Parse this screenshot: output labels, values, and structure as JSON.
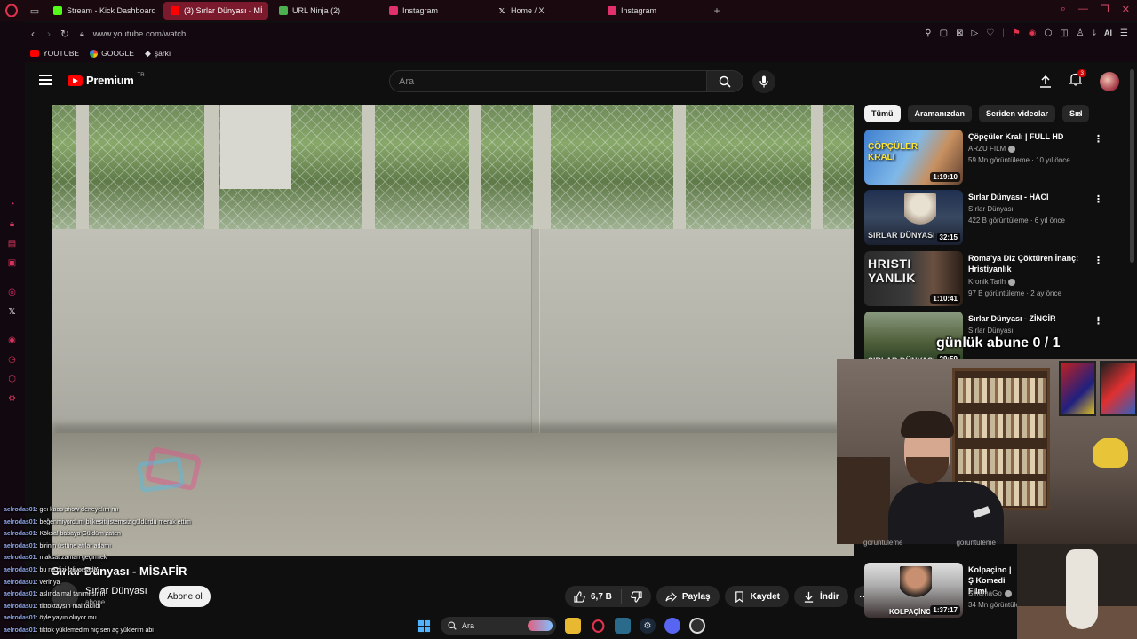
{
  "browser": {
    "tabs": [
      {
        "label": "Stream - Kick Dashboard",
        "icon": "kick-icon",
        "color": "#53fc18"
      },
      {
        "label": "(3) Sırlar Dünyası - Mİ",
        "icon": "youtube-icon",
        "color": "#ff0000",
        "active": true
      },
      {
        "label": "URL Ninja (2)",
        "icon": "ninja-icon",
        "color": "#4caf50"
      },
      {
        "label": "Instagram",
        "icon": "instagram-icon",
        "color": "#e1306c"
      },
      {
        "label": "Home / X",
        "icon": "x-icon",
        "color": "#ffffff"
      },
      {
        "label": "Instagram",
        "icon": "instagram-icon",
        "color": "#e1306c"
      }
    ],
    "new_tab": "+",
    "url": "www.youtube.com/watch",
    "bookmarks": [
      {
        "label": "YOUTUBE",
        "icon": "youtube-icon"
      },
      {
        "label": "GOOGLE",
        "icon": "google-icon"
      },
      {
        "label": "şarkı",
        "icon": "bookmark-icon"
      }
    ],
    "ai_label": "AI"
  },
  "youtube": {
    "logo_word": "Premium",
    "logo_region": "TR",
    "search_placeholder": "Ara",
    "notifications_count": "3",
    "video_title": "Sırlar Dünyası - MİSAFİR",
    "channel_name": "Sırlar Dünyası",
    "channel_subs": "abone",
    "subscribe_label": "Abone ol",
    "like_count": "6,7 B",
    "share_label": "Paylaş",
    "save_label": "Kaydet",
    "download_label": "İndir",
    "chips": [
      "Tümü",
      "Aramanızdan",
      "Seriden videolar",
      "Sırl"
    ],
    "recommendations": [
      {
        "title": "Çöpçüler Kralı | FULL HD",
        "channel": "ARZU FILM",
        "verified": true,
        "views": "59 Mn görüntüleme",
        "age": "10 yıl önce",
        "duration": "1:19:10",
        "thumb_text": "ÇÖPÇÜLER KRALI"
      },
      {
        "title": "Sırlar Dünyası - HACI",
        "channel": "Sırlar Dünyası",
        "verified": false,
        "views": "422 B görüntüleme",
        "age": "6 yıl önce",
        "duration": "32:15",
        "thumb_text": "SIRLAR DÜNYASI"
      },
      {
        "title": "Roma'ya Diz Çöktüren İnanç: Hristiyanlık",
        "channel": "Kronik Tarih",
        "verified": true,
        "views": "97 B görüntüleme",
        "age": "2 ay önce",
        "duration": "1:10:41",
        "thumb_text": "HRISTI YANLIK"
      },
      {
        "title": "Sırlar Dünyası - ZİNCİR",
        "channel": "Sırlar Dünyası",
        "verified": false,
        "views": "",
        "age": "",
        "duration": "29:59",
        "thumb_text": "SIRLAR DÜNYASI"
      }
    ],
    "partial_rec": {
      "title": "Kolpaçino | Ş Komedi Filmi",
      "channel": "SinemaGo",
      "views": "34 Mn görüntülem",
      "duration": "1:37:17",
      "thumb_text": "KOLPAÇİNO"
    },
    "hidden_views": [
      "görüntüleme",
      "görüntüleme"
    ]
  },
  "overlay": {
    "abone_goal": "günlük abune 0 / 1"
  },
  "chat": [
    {
      "user": "aelrodas01",
      "msg": "geı kaos show deneyelım mı"
    },
    {
      "user": "aelrodas01",
      "msg": "beğenmiyordum bi kesiti istemsiz güldürdü merak ettim"
    },
    {
      "user": "aelrodas01",
      "msg": "Köksal babaya Güldüm zaten"
    },
    {
      "user": "aelrodas01",
      "msg": "birinin üstüne atılar adamı"
    },
    {
      "user": "aelrodas01",
      "msg": "maksat zaman geçirmek"
    },
    {
      "user": "aelrodas01",
      "msg": "bu ne dizi izliyorsada"
    },
    {
      "user": "aelrodas01",
      "msg": "verir ya"
    },
    {
      "user": "aelrodas01",
      "msg": "aslında mal tanımlısının"
    },
    {
      "user": "aelrodas01",
      "msg": "tiktoktaysın mal takıldı"
    },
    {
      "user": "aelrodas01",
      "msg": "öyle yayın oluyor mu"
    },
    {
      "user": "aelrodas01",
      "msg": "tiktok yüklemedim hiç sen aç yüklerim abi"
    }
  ],
  "taskbar": {
    "search_label": "Ara"
  },
  "colors": {
    "accent": "#ff0000",
    "tab_active": "#7a1a2c",
    "chat_user": "#8fa6e8",
    "opera_red": "#d3355c"
  }
}
